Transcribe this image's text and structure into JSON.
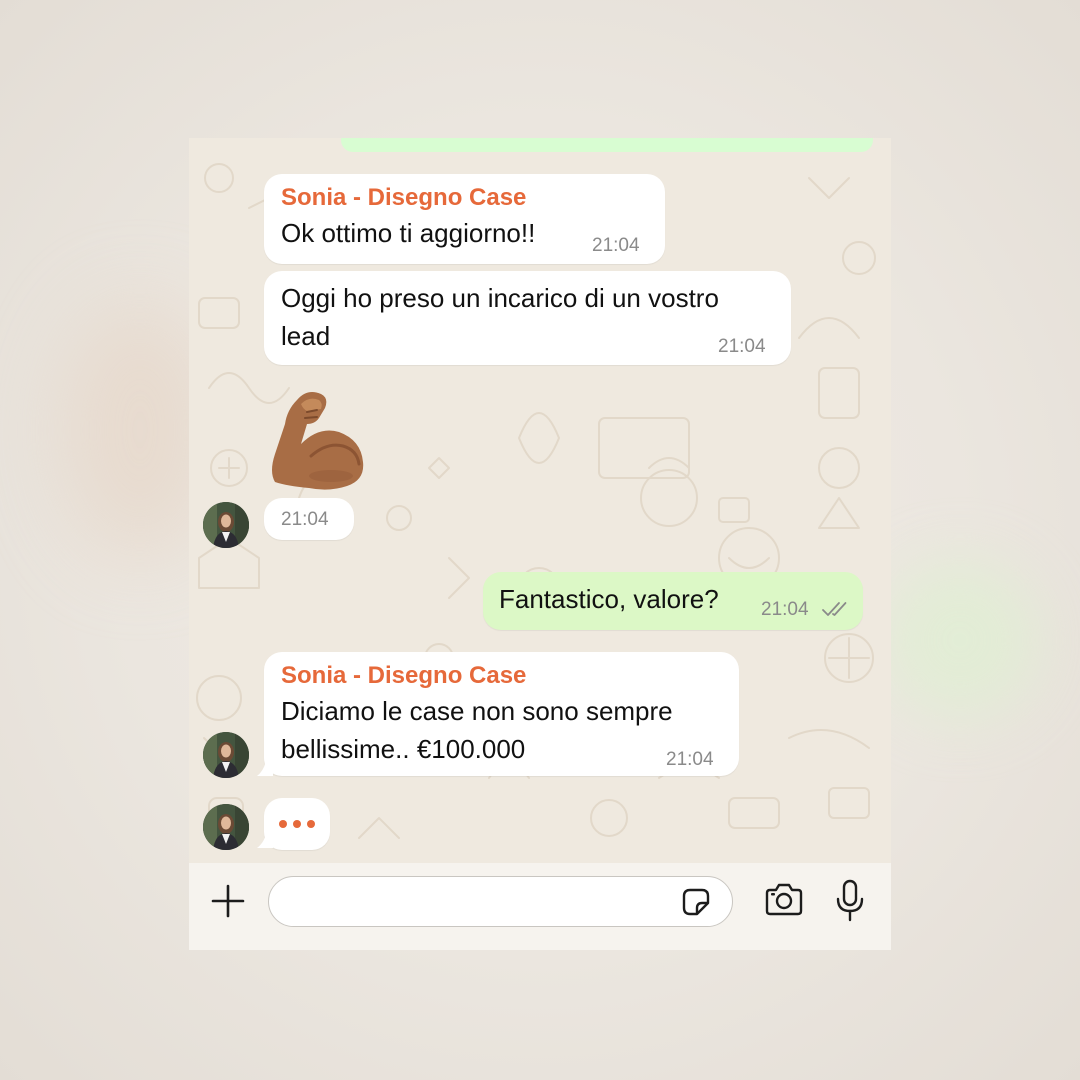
{
  "colors": {
    "sender": "#e6693a",
    "incoming_bubble": "#ffffff",
    "outgoing_bubble": "#dcf8c6",
    "chat_background": "#efe9df",
    "timestamp": "#8a8a8a",
    "read_ticks": "#8a8a8a"
  },
  "messages": [
    {
      "direction": "incoming",
      "sender": "Sonia - Disegno Case",
      "text": "Ok ottimo ti aggiorno!!",
      "time": "21:04"
    },
    {
      "direction": "incoming",
      "text_line1": "Oggi ho preso un incarico di un vostro",
      "text_line2": "lead",
      "time": "21:04"
    },
    {
      "direction": "incoming",
      "emoji": "flexed-biceps",
      "time": "21:04"
    },
    {
      "direction": "outgoing",
      "text": "Fantastico, valore?",
      "time": "21:04",
      "status": "read"
    },
    {
      "direction": "incoming",
      "sender": "Sonia - Disegno Case",
      "text_line1": "Diciamo le case non sono sempre",
      "text_line2": "bellissime.. €100.000",
      "time": "21:04"
    }
  ],
  "typing_indicator": {
    "dots": "•••"
  },
  "input_bar": {
    "placeholder": "",
    "icons": [
      "plus-icon",
      "sticker-icon",
      "camera-icon",
      "microphone-icon"
    ]
  }
}
